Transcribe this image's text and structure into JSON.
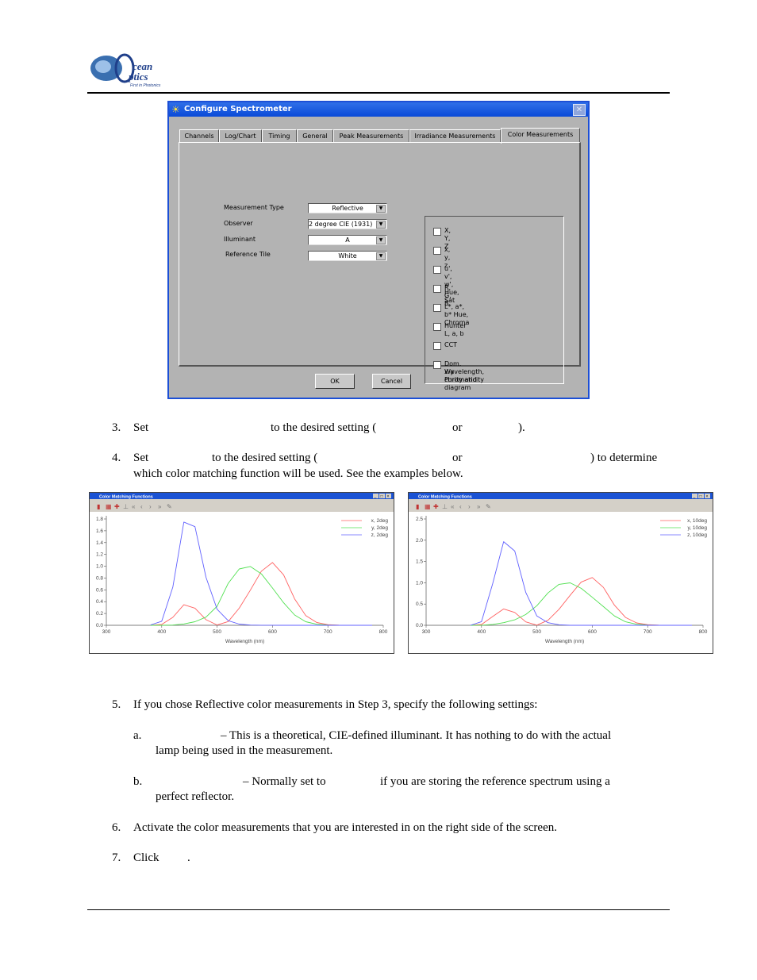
{
  "header": {
    "logo_text": "Ocean Optics Inc. First in Photonics"
  },
  "dialog": {
    "title": "Configure Spectrometer",
    "tabs": [
      "Channels",
      "Log/Chart",
      "Timing",
      "General",
      "Peak Measurements",
      "Irradiance Measurements",
      "Color Measurements"
    ],
    "active_tab": "Color Measurements",
    "fields": [
      {
        "label": "Measurement Type",
        "value": "Reflective"
      },
      {
        "label": "Observer",
        "value": "2 degree CIE (1931)"
      },
      {
        "label": "Illuminant",
        "value": "A"
      },
      {
        "label": "Reference Tile",
        "value": "White"
      }
    ],
    "checkboxes": [
      "X, Y, Z",
      "x, y, z",
      "u', v', w', Hue, Sat",
      "R, G, B",
      "L*, a*, b* Hue, Chroma",
      "Hunter L, a, b",
      "CCT",
      "Dom. Wavelength, Purity and",
      "x-y chromaticity diagram"
    ],
    "ok": "OK",
    "cancel": "Cancel"
  },
  "steps": {
    "s3": {
      "num": "3.",
      "a": "Set",
      "b": "to the desired setting (",
      "c": "or",
      "d": ")."
    },
    "s4": {
      "num": "4.",
      "a": "Set",
      "b": "to the desired setting (",
      "c": "or",
      "d": ") to determine",
      "e": "which color matching function will be used. See the examples below."
    },
    "s5": {
      "num": "5.",
      "text": "If you chose Reflective color measurements in Step 3, specify the following settings:"
    },
    "s5a": {
      "num": "a.",
      "a": "– This is a theoretical, CIE-defined illuminant. It has nothing to do with the actual",
      "b": "lamp being used in the measurement."
    },
    "s5b": {
      "num": "b.",
      "a": "– Normally set to",
      "b": "if you are storing the reference spectrum using a",
      "c": "perfect reflector."
    },
    "s6": {
      "num": "6.",
      "text": "Activate the color measurements that you are interested in on the right side of the screen."
    },
    "s7": {
      "num": "7.",
      "a": "Click",
      "b": "."
    }
  },
  "chart_data": [
    {
      "type": "line",
      "window_title": "Color Matching Functions",
      "xlabel": "Wavelength (nm)",
      "ylabel": "",
      "xlim": [
        300,
        800
      ],
      "ylim": [
        0,
        1.8
      ],
      "xticks": [
        300,
        400,
        500,
        600,
        700,
        800
      ],
      "yticks": [
        "0.0",
        "0.2",
        "0.4",
        "0.6",
        "0.8",
        "1.0",
        "1.2",
        "1.4",
        "1.6",
        "1.8"
      ],
      "legend": "top-right",
      "grid": false,
      "x": [
        380,
        400,
        420,
        440,
        460,
        480,
        500,
        520,
        540,
        560,
        580,
        600,
        620,
        640,
        660,
        680,
        700,
        720,
        740,
        760,
        780
      ],
      "series": [
        {
          "name": "x, 2deg",
          "color": "#ff6060",
          "values": [
            0.0014,
            0.0143,
            0.1344,
            0.3483,
            0.2908,
            0.0956,
            0.0049,
            0.0633,
            0.2904,
            0.5945,
            0.9163,
            1.0622,
            0.8544,
            0.4479,
            0.1649,
            0.0468,
            0.0114,
            0.0029,
            0.0007,
            0.0002,
            0
          ]
        },
        {
          "name": "y, 2deg",
          "color": "#50e050",
          "values": [
            0,
            0.0004,
            0.004,
            0.023,
            0.06,
            0.139,
            0.323,
            0.71,
            0.954,
            0.995,
            0.87,
            0.631,
            0.381,
            0.175,
            0.061,
            0.017,
            0.0041,
            0.001,
            0.0003,
            0.0001,
            0
          ]
        },
        {
          "name": "z, 2deg",
          "color": "#6060ff",
          "values": [
            0.0065,
            0.0679,
            0.6456,
            1.7471,
            1.6692,
            0.813,
            0.272,
            0.0782,
            0.0203,
            0.0039,
            0.0017,
            0.0008,
            0.0002,
            0,
            0,
            0,
            0,
            0,
            0,
            0,
            0
          ]
        }
      ]
    },
    {
      "type": "line",
      "window_title": "Color Matching Functions",
      "xlabel": "Wavelength (nm)",
      "ylabel": "",
      "xlim": [
        300,
        800
      ],
      "ylim": [
        0,
        2.5
      ],
      "xticks": [
        300,
        400,
        500,
        600,
        700,
        800
      ],
      "yticks": [
        "0.0",
        "0.5",
        "1.0",
        "1.5",
        "2.0",
        "2.5"
      ],
      "legend": "top-right",
      "grid": false,
      "x": [
        380,
        400,
        420,
        440,
        460,
        480,
        500,
        520,
        540,
        560,
        580,
        600,
        620,
        640,
        660,
        680,
        700,
        720,
        740,
        760,
        780
      ],
      "series": [
        {
          "name": "x, 10deg",
          "color": "#ff6060",
          "values": [
            0.0002,
            0.0191,
            0.2045,
            0.3837,
            0.3023,
            0.0805,
            0.0038,
            0.1177,
            0.3768,
            0.7052,
            1.0142,
            1.124,
            0.8924,
            0.4734,
            0.1838,
            0.0551,
            0.0143,
            0.0034,
            0.0008,
            0.0002,
            0
          ]
        },
        {
          "name": "y, 10deg",
          "color": "#50e050",
          "values": [
            0,
            0.002,
            0.0214,
            0.0621,
            0.1282,
            0.2536,
            0.4608,
            0.7618,
            0.962,
            0.9973,
            0.8689,
            0.6583,
            0.4412,
            0.221,
            0.0822,
            0.0244,
            0.006,
            0.0014,
            0.0003,
            0.0001,
            0
          ]
        },
        {
          "name": "z, 10deg",
          "color": "#6060ff",
          "values": [
            0.0007,
            0.086,
            0.9725,
            1.9673,
            1.7454,
            0.7721,
            0.2185,
            0.0608,
            0.0137,
            0.0002,
            0,
            0,
            0,
            0,
            0,
            0,
            0,
            0,
            0,
            0,
            0
          ]
        }
      ]
    }
  ]
}
